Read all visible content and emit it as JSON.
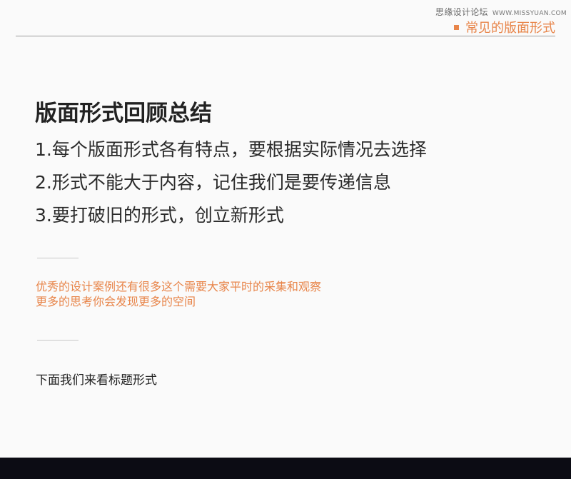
{
  "watermark": {
    "site_name": "思缘设计论坛",
    "domain": "WWW.MISSYUAN.COM"
  },
  "section_tag": "常见的版面形式",
  "title": "版面形式回顾总结",
  "points": [
    "1.每个版面形式各有特点，要根据实际情况去选择",
    "2.形式不能大于内容，记住我们是要传递信息",
    "3.要打破旧的形式，创立新形式"
  ],
  "note": {
    "line1": "优秀的设计案例还有很多这个需要大家平时的采集和观察",
    "line2": "更多的思考你会发现更多的空间"
  },
  "next_text": "下面我们来看标题形式",
  "colors": {
    "accent": "#e8854a",
    "background": "#fafafa",
    "footer": "#0c0c14"
  }
}
